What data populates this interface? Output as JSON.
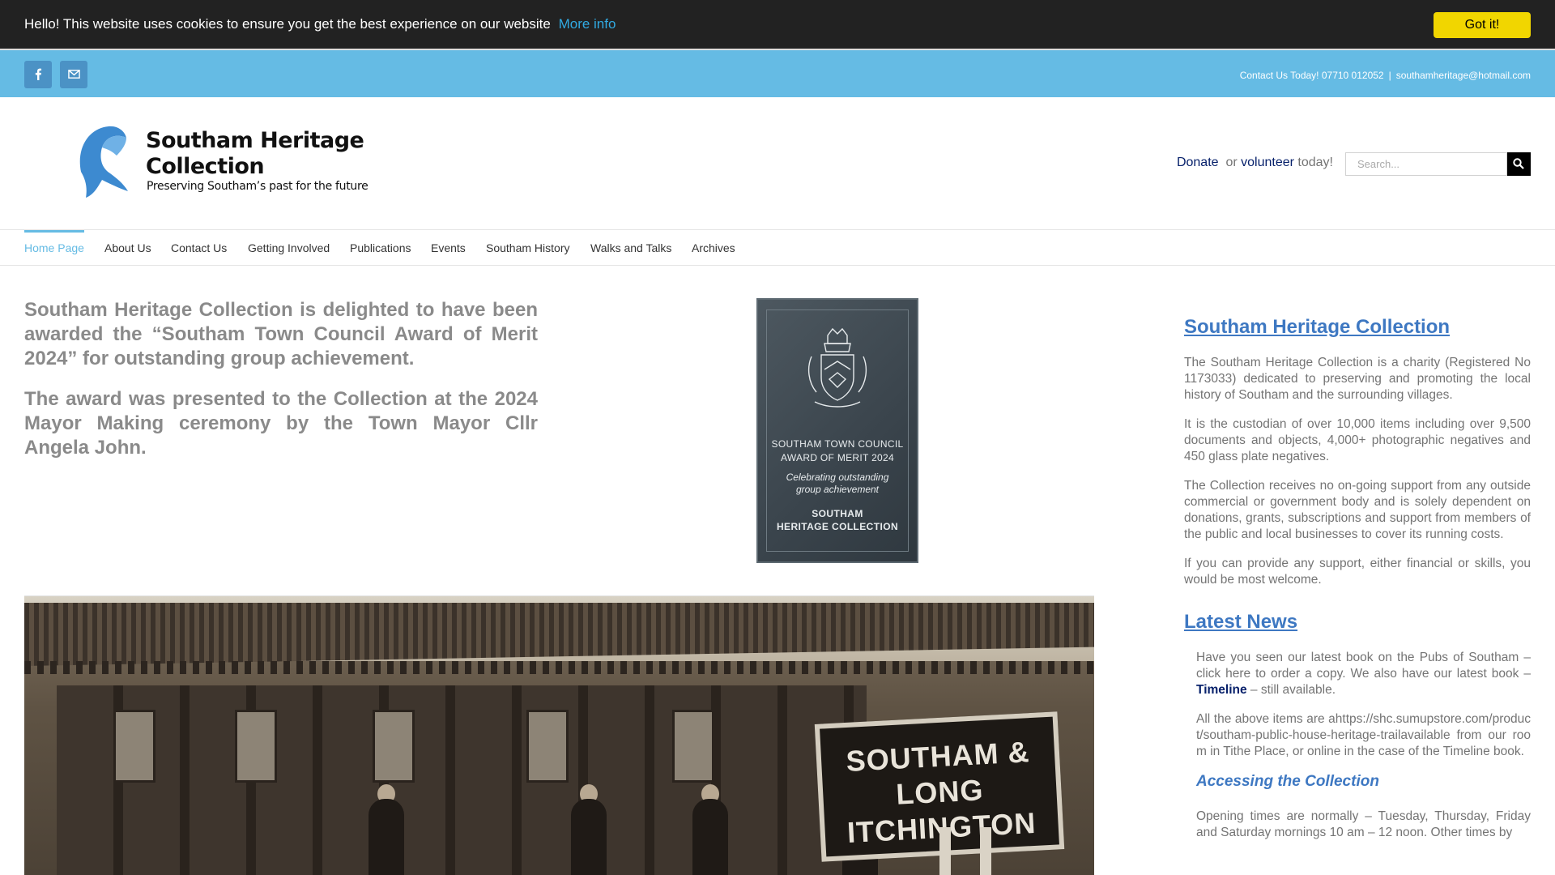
{
  "cookie": {
    "message": "Hello! This website uses cookies to ensure you get the best experience on our website",
    "more_info": "More info",
    "accept": "Got it!"
  },
  "topbar": {
    "social": [
      "facebook-icon",
      "mail-icon"
    ],
    "contact": "Contact Us Today! 07710 012052",
    "separator": "|",
    "email": "southamheritage@hotmail.com"
  },
  "header": {
    "logo_title_line1": "Southam Heritage",
    "logo_title_line2": "Collection",
    "logo_tagline": "Preserving Southam’s past for the future",
    "donate": "Donate",
    "or": "or",
    "volunteer": "volunteer",
    "today": "today!",
    "search_placeholder": "Search..."
  },
  "nav": {
    "items": [
      "Home Page",
      "About Us",
      "Contact Us",
      "Getting Involved",
      "Publications",
      "Events",
      "Southam History",
      "Walks and Talks",
      "Archives"
    ],
    "active": "Home Page"
  },
  "main": {
    "intro_p1": "Southam Heritage Collection is delighted to have been awarded the “Southam Town Council Award of Merit 2024” for outstanding group achievement.",
    "intro_p2": "The award was presented to the Collection at the 2024 Mayor Making ceremony by the Town Mayor Cllr Angela John.",
    "plaque_line1": "SOUTHAM TOWN COUNCIL",
    "plaque_line2": "AWARD OF MERIT 2024",
    "plaque_line3": "Celebrating outstanding",
    "plaque_line4": "group achievement",
    "plaque_line5": "SOUTHAM",
    "plaque_line6": "HERITAGE COLLECTION",
    "photo_sign_line1": "SOUTHAM &",
    "photo_sign_line2": "LONG ITCHINGTON"
  },
  "sidebar": {
    "heading": "Southam Heritage Collection",
    "p1": "The Southam Heritage Collection is a charity (Registered No 1173033) dedicated to preserving and promoting the local history of Southam and the surrounding villages.",
    "p2": "It is the custodian of over 10,000 items including over 9,500 documents and objects, 4,000+ photographic negatives and 450 glass plate negatives.",
    "p3": "The Collection receives no on-going support from any outside commercial or government body and is solely dependent on donations, grants, subscriptions and support from members of the public and local businesses to cover its running costs.",
    "p4": "If you can provide any support, either financial or skills, you would be most welcome.",
    "news_heading": "Latest News",
    "news_p1_pre": "Have you seen our latest book on the Pubs of Southam – click here to order a copy. We also have our latest book –",
    "news_p1_link": "Timeline",
    "news_p1_post": "– still available.",
    "news_p2": "All the above items are ahttps://shc.sumupstore.com/product/southam-public-house-heritage-trailavailable from our room in Tithe Place, or online in the case of the Timeline book.",
    "access_heading": "Accessing the Collection",
    "access_p1": "Opening times are normally – Tuesday, Thursday, Friday and Saturday mornings 10 am – 12 noon. Other times by"
  }
}
